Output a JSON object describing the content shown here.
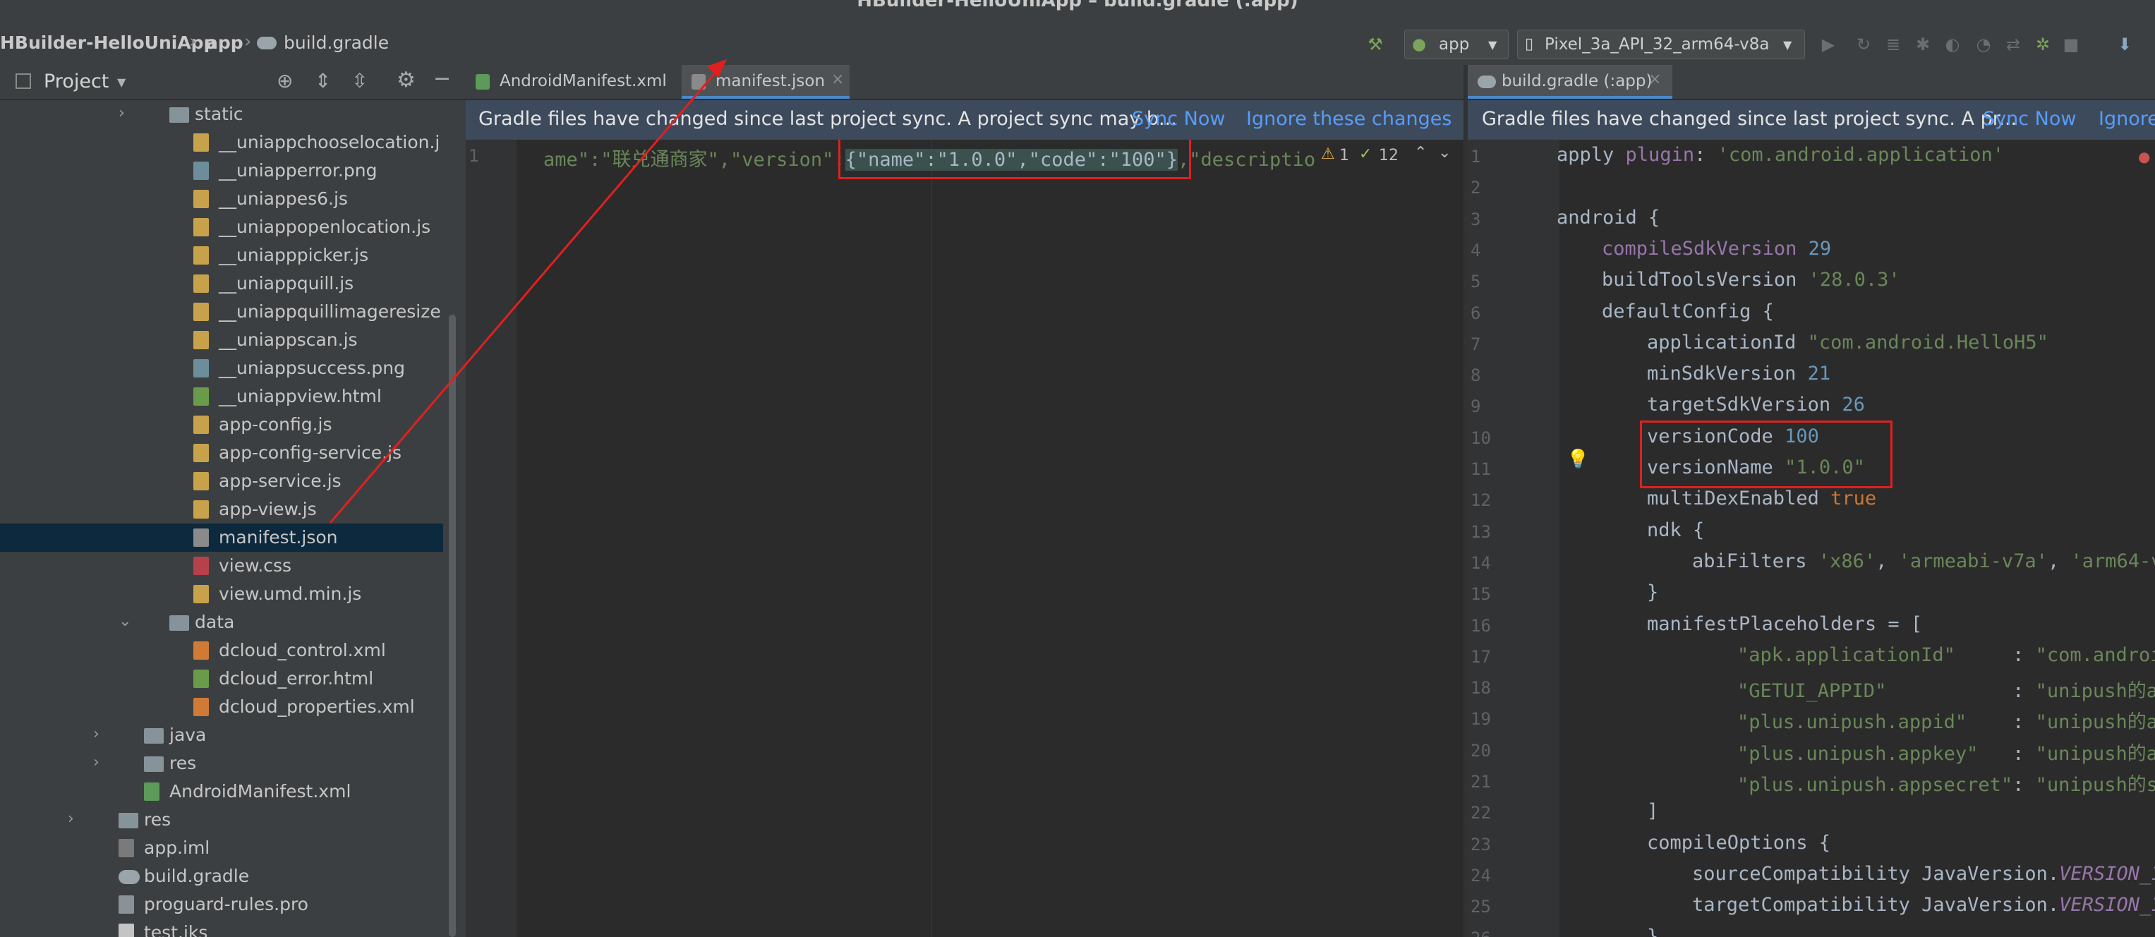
{
  "window": {
    "title": "HBuilder-HelloUniApp – build.gradle (:app)"
  },
  "breadcrumb": [
    "HBuilder-HelloUniApp",
    "app",
    "build.gradle"
  ],
  "toolbar": {
    "run_config": "app",
    "device": "Pixel_3a_API_32_arm64-v8a"
  },
  "project_panel": {
    "title": "Project",
    "tree": [
      {
        "label": "static",
        "type": "folder",
        "level": 4,
        "expanded": false
      },
      {
        "label": "__uniappchooselocation.j",
        "type": "js",
        "level": 5
      },
      {
        "label": "__uniapperror.png",
        "type": "png",
        "level": 5
      },
      {
        "label": "__uniappes6.js",
        "type": "js",
        "level": 5
      },
      {
        "label": "__uniappopenlocation.js",
        "type": "js",
        "level": 5
      },
      {
        "label": "__uniapppicker.js",
        "type": "js",
        "level": 5
      },
      {
        "label": "__uniappquill.js",
        "type": "js",
        "level": 5
      },
      {
        "label": "__uniappquillimageresize",
        "type": "js",
        "level": 5
      },
      {
        "label": "__uniappscan.js",
        "type": "js",
        "level": 5
      },
      {
        "label": "__uniappsuccess.png",
        "type": "png",
        "level": 5
      },
      {
        "label": "__uniappview.html",
        "type": "html",
        "level": 5
      },
      {
        "label": "app-config.js",
        "type": "js",
        "level": 5
      },
      {
        "label": "app-config-service.js",
        "type": "js",
        "level": 5
      },
      {
        "label": "app-service.js",
        "type": "js",
        "level": 5
      },
      {
        "label": "app-view.js",
        "type": "js",
        "level": 5
      },
      {
        "label": "manifest.json",
        "type": "json",
        "level": 5,
        "selected": true
      },
      {
        "label": "view.css",
        "type": "css",
        "level": 5
      },
      {
        "label": "view.umd.min.js",
        "type": "js",
        "level": 5
      },
      {
        "label": "data",
        "type": "folder",
        "level": 4,
        "expanded": true
      },
      {
        "label": "dcloud_control.xml",
        "type": "xml",
        "level": 5
      },
      {
        "label": "dcloud_error.html",
        "type": "html",
        "level": 5
      },
      {
        "label": "dcloud_properties.xml",
        "type": "xml",
        "level": 5
      },
      {
        "label": "java",
        "type": "folder",
        "level": 3,
        "expanded": false
      },
      {
        "label": "res",
        "type": "folder",
        "level": 3,
        "expanded": false
      },
      {
        "label": "AndroidManifest.xml",
        "type": "mf",
        "level": 3
      },
      {
        "label": "res",
        "type": "folder",
        "level": 2,
        "expanded": false
      },
      {
        "label": "app.iml",
        "type": "iml",
        "level": 2
      },
      {
        "label": "build.gradle",
        "type": "gradle",
        "level": 2
      },
      {
        "label": "proguard-rules.pro",
        "type": "pro",
        "level": 2
      },
      {
        "label": "test.jks",
        "type": "jks",
        "level": 2
      }
    ]
  },
  "left_editor": {
    "tabs": [
      "AndroidManifest.xml",
      "manifest.json"
    ],
    "active_tab": "manifest.json",
    "banner": {
      "message": "Gradle files have changed since last project sync. A project sync may b...",
      "sync_now": "Sync Now",
      "ignore": "Ignore these changes"
    },
    "line_number": "1",
    "code_prefix": "ame\":\"联兑通商家\",\"version\":",
    "code_highlight": "{\"name\":\"1.0.0\",\"code\":\"100\"}",
    "code_suffix": ",\"descriptio",
    "inspection": {
      "warnings": "1",
      "weak_warnings": "12"
    }
  },
  "right_editor": {
    "tabs": [
      "build.gradle (:app)"
    ],
    "active_tab": "build.gradle (:app)",
    "banner": {
      "message": "Gradle files have changed since last project sync. A pr...",
      "sync_now": "Sync Now",
      "ignore": "Ignore"
    },
    "lines": [
      {
        "n": "1",
        "indent": 0,
        "parts": [
          [
            "plain",
            "apply "
          ],
          [
            "prop",
            "plugin"
          ],
          [
            "plain",
            ": "
          ],
          [
            "str",
            "'com.android.application'"
          ]
        ]
      },
      {
        "n": "2",
        "indent": 0,
        "parts": []
      },
      {
        "n": "3",
        "indent": 0,
        "parts": [
          [
            "plain",
            "android {"
          ]
        ]
      },
      {
        "n": "4",
        "indent": 1,
        "parts": [
          [
            "prop",
            "compileSdkVersion "
          ],
          [
            "num",
            "29"
          ]
        ]
      },
      {
        "n": "5",
        "indent": 1,
        "parts": [
          [
            "plain",
            "buildToolsVersion "
          ],
          [
            "str",
            "'28.0.3'"
          ]
        ]
      },
      {
        "n": "6",
        "indent": 1,
        "parts": [
          [
            "plain",
            "defaultConfig {"
          ]
        ]
      },
      {
        "n": "7",
        "indent": 2,
        "parts": [
          [
            "plain",
            "applicationId "
          ],
          [
            "str",
            "\"com.android.HelloH5\""
          ]
        ]
      },
      {
        "n": "8",
        "indent": 2,
        "parts": [
          [
            "plain",
            "minSdkVersion "
          ],
          [
            "num",
            "21"
          ]
        ]
      },
      {
        "n": "9",
        "indent": 2,
        "parts": [
          [
            "plain",
            "targetSdkVersion "
          ],
          [
            "num",
            "26"
          ]
        ]
      },
      {
        "n": "10",
        "indent": 2,
        "parts": [
          [
            "plain",
            "versionCode "
          ],
          [
            "num",
            "100"
          ]
        ]
      },
      {
        "n": "11",
        "indent": 2,
        "parts": [
          [
            "plain",
            "versionName "
          ],
          [
            "str",
            "\"1.0.0\""
          ]
        ]
      },
      {
        "n": "12",
        "indent": 2,
        "parts": [
          [
            "plain",
            "multiDexEnabled "
          ],
          [
            "kw",
            "true"
          ]
        ]
      },
      {
        "n": "13",
        "indent": 2,
        "parts": [
          [
            "plain",
            "ndk {"
          ]
        ]
      },
      {
        "n": "14",
        "indent": 3,
        "parts": [
          [
            "plain",
            "abiFilters "
          ],
          [
            "str",
            "'x86'"
          ],
          [
            "plain",
            ", "
          ],
          [
            "str",
            "'armeabi-v7a'"
          ],
          [
            "plain",
            ", "
          ],
          [
            "str",
            "'arm64-v"
          ]
        ]
      },
      {
        "n": "15",
        "indent": 2,
        "parts": [
          [
            "plain",
            "}"
          ]
        ]
      },
      {
        "n": "16",
        "indent": 2,
        "parts": [
          [
            "plain",
            "manifestPlaceholders = ["
          ]
        ]
      },
      {
        "n": "17",
        "indent": 4,
        "parts": [
          [
            "str",
            "\"apk.applicationId\""
          ],
          [
            "plain",
            "     : "
          ],
          [
            "str",
            "\"com.androi"
          ]
        ]
      },
      {
        "n": "18",
        "indent": 4,
        "parts": [
          [
            "str",
            "\"GETUI_APPID\""
          ],
          [
            "plain",
            "           : "
          ],
          [
            "str",
            "\"unipush的ap"
          ]
        ]
      },
      {
        "n": "19",
        "indent": 4,
        "parts": [
          [
            "str",
            "\"plus.unipush.appid\""
          ],
          [
            "plain",
            "    : "
          ],
          [
            "str",
            "\"unipush的ap"
          ]
        ]
      },
      {
        "n": "20",
        "indent": 4,
        "parts": [
          [
            "str",
            "\"plus.unipush.appkey\""
          ],
          [
            "plain",
            "   : "
          ],
          [
            "str",
            "\"unipush的a"
          ]
        ]
      },
      {
        "n": "21",
        "indent": 4,
        "parts": [
          [
            "str",
            "\"plus.unipush.appsecret\""
          ],
          [
            "plain",
            ": "
          ],
          [
            "str",
            "\"unipush的se"
          ]
        ]
      },
      {
        "n": "22",
        "indent": 2,
        "parts": [
          [
            "plain",
            "]"
          ]
        ]
      },
      {
        "n": "23",
        "indent": 2,
        "parts": [
          [
            "plain",
            "compileOptions {"
          ]
        ]
      },
      {
        "n": "24",
        "indent": 3,
        "parts": [
          [
            "plain",
            "sourceCompatibility JavaVersion."
          ],
          [
            "it",
            "VERSION_1"
          ]
        ]
      },
      {
        "n": "25",
        "indent": 3,
        "parts": [
          [
            "plain",
            "targetCompatibility JavaVersion."
          ],
          [
            "it",
            "VERSION_1"
          ]
        ]
      },
      {
        "n": "26",
        "indent": 2,
        "parts": [
          [
            "plain",
            "}"
          ]
        ]
      }
    ]
  },
  "colors": {
    "highlight_box": "#e02020",
    "annotation_arrow": "#e02020",
    "selection": "#0d293e"
  }
}
